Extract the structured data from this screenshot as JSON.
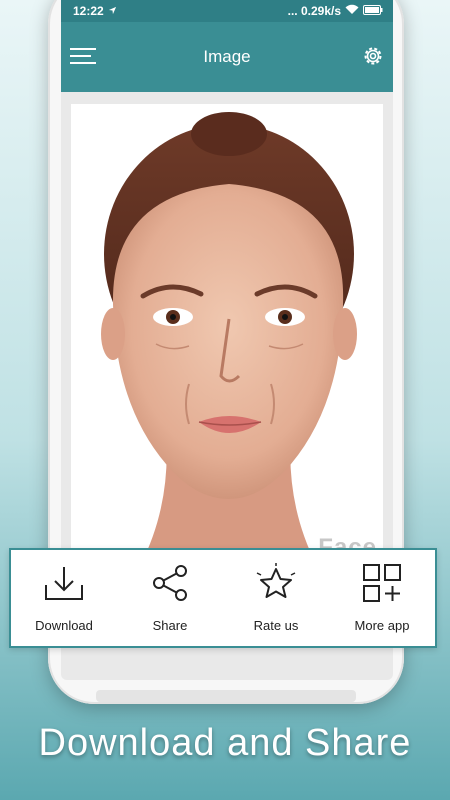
{
  "status_bar": {
    "time": "12:22",
    "network_speed": "... 0.29k/s",
    "icons": [
      "navigation-arrow-icon",
      "wifi-icon",
      "battery-icon"
    ]
  },
  "app_bar": {
    "title": "Image",
    "icons": [
      "menu-icon",
      "settings-icon"
    ]
  },
  "image": {
    "description": "aged face portrait",
    "watermark": "Face"
  },
  "actions": [
    {
      "label": "Download",
      "icon": "download-icon"
    },
    {
      "label": "Share",
      "icon": "share-icon"
    },
    {
      "label": "Rate us",
      "icon": "star-icon"
    },
    {
      "label": "More app",
      "icon": "more-apps-icon"
    }
  ],
  "headline": "Download and Share",
  "colors": {
    "app_bar": "#3a8e94",
    "status_bar": "#2f7f86",
    "accent_border": "#3a8e94",
    "background_bottom": "#5ba8b0"
  }
}
